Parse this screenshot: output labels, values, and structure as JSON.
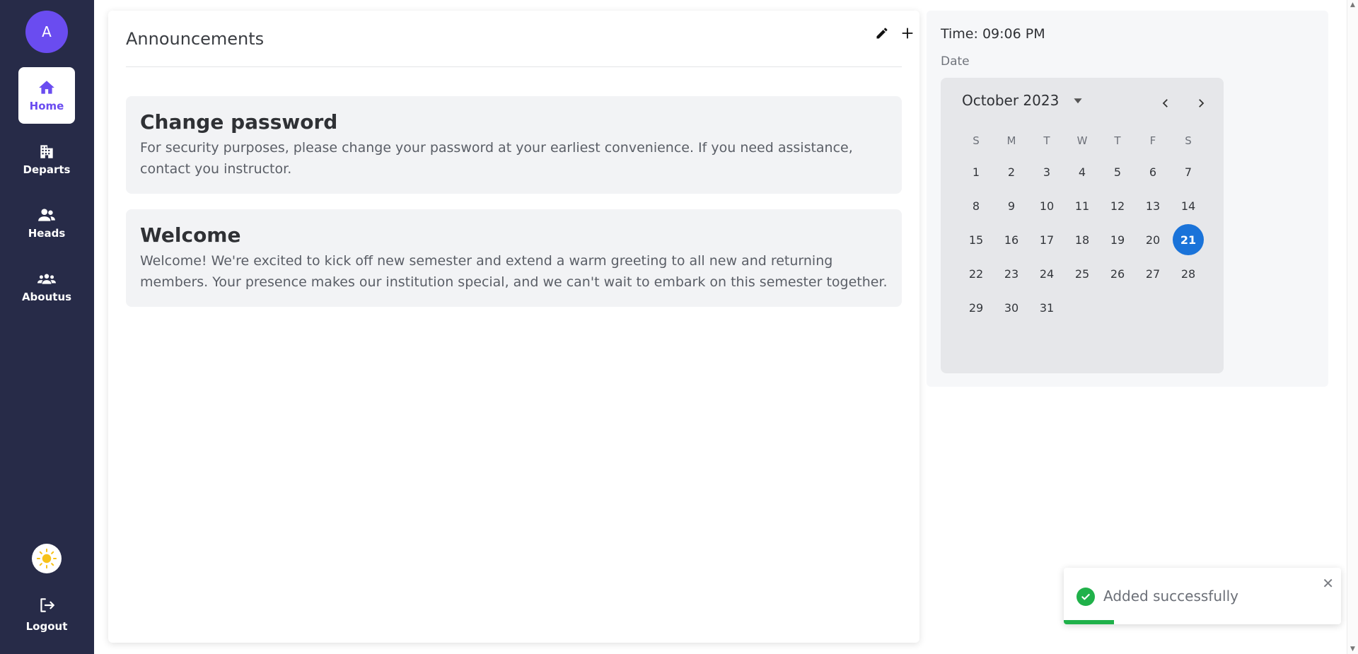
{
  "sidebar": {
    "avatar_initial": "A",
    "items": [
      {
        "label": "Home",
        "icon": "home-icon"
      },
      {
        "label": "Departs",
        "icon": "building-icon"
      },
      {
        "label": "Heads",
        "icon": "users-icon"
      },
      {
        "label": "Aboutus",
        "icon": "group-icon"
      }
    ],
    "theme_icon": "sun-icon",
    "logout_label": "Logout"
  },
  "announcements": {
    "title": "Announcements",
    "edit_icon": "pencil-icon",
    "add_icon": "plus-icon",
    "items": [
      {
        "title": "Change password",
        "body": "For security purposes, please change your password at your earliest convenience. If you need assistance, contact you instructor."
      },
      {
        "title": "Welcome",
        "body": "Welcome! We're excited to kick off new semester and extend a warm greeting to all new and returning members. Your presence makes our institution special, and we can't wait to embark on this semester together."
      }
    ]
  },
  "clock": {
    "time_text": "Time: 09:06 PM",
    "date_label": "Date"
  },
  "calendar": {
    "month_year": "October 2023",
    "weekdays": [
      "S",
      "M",
      "T",
      "W",
      "T",
      "F",
      "S"
    ],
    "days": [
      [
        "1",
        "2",
        "3",
        "4",
        "5",
        "6",
        "7"
      ],
      [
        "8",
        "9",
        "10",
        "11",
        "12",
        "13",
        "14"
      ],
      [
        "15",
        "16",
        "17",
        "18",
        "19",
        "20",
        "21"
      ],
      [
        "22",
        "23",
        "24",
        "25",
        "26",
        "27",
        "28"
      ],
      [
        "29",
        "30",
        "31",
        "",
        "",
        "",
        ""
      ]
    ],
    "selected_day": "21",
    "accent_color": "#1a73d9"
  },
  "toast": {
    "message": "Added successfully",
    "close_symbol": "✕",
    "progress": 0.18,
    "color": "#20b14a"
  },
  "colors": {
    "sidebar_bg": "#272b48",
    "accent": "#6a4cf0"
  }
}
